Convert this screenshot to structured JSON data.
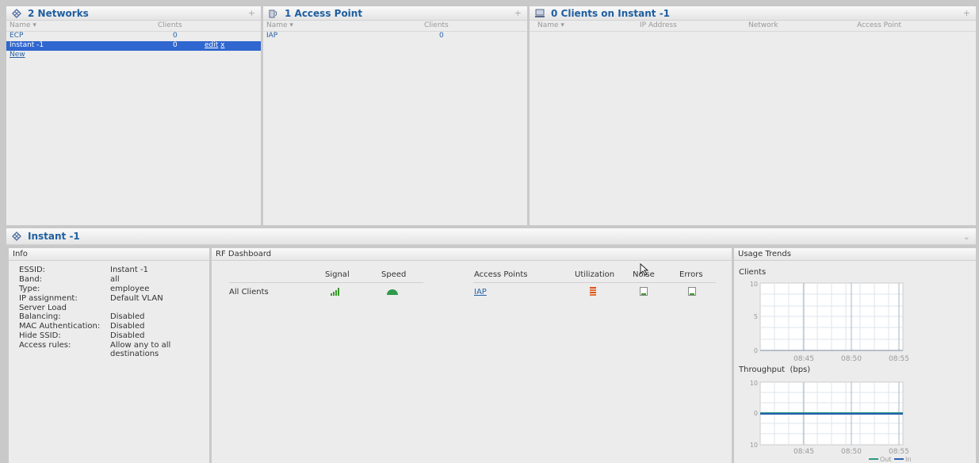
{
  "networks": {
    "title": "2 Networks",
    "columns": [
      "Name",
      "Clients"
    ],
    "rows": [
      {
        "name": "ECP",
        "clients": "0"
      },
      {
        "name": "Instant -1",
        "clients": "0",
        "edit": "edit",
        "remove": "x"
      }
    ],
    "new_link": "New"
  },
  "access_points": {
    "title": "1 Access Point",
    "columns": [
      "Name",
      "Clients"
    ],
    "rows": [
      {
        "name": "IAP",
        "clients": "0"
      }
    ]
  },
  "clients_panel": {
    "title": "0 Clients on Instant -1",
    "columns": [
      "Name",
      "IP Address",
      "Network",
      "Access Point"
    ]
  },
  "detail": {
    "title": "Instant -1",
    "info": {
      "header": "Info",
      "fields": [
        {
          "label": "ESSID:",
          "value": "Instant -1"
        },
        {
          "label": "Band:",
          "value": "all"
        },
        {
          "label": "Type:",
          "value": "employee"
        },
        {
          "label": "IP assignment:",
          "value": "Default VLAN"
        },
        {
          "label": "Server Load Balancing:",
          "value": "Disabled"
        },
        {
          "label": "MAC Authentication:",
          "value": "Disabled"
        },
        {
          "label": "Hide SSID:",
          "value": "Disabled"
        },
        {
          "label": "Access rules:",
          "value": "Allow any to all destinations"
        }
      ]
    },
    "rf": {
      "header": "RF Dashboard",
      "columns_left": [
        "Signal",
        "Speed"
      ],
      "columns_right": [
        "Access Points",
        "Utilization",
        "Noise",
        "Errors"
      ],
      "row_label": "All Clients",
      "ap_link": "IAP"
    },
    "trends": {
      "header": "Usage Trends",
      "clients_chart": {
        "title": "Clients",
        "yticks": [
          "10",
          "5",
          "0"
        ],
        "xticks": [
          "08:45",
          "08:50",
          "08:55"
        ]
      },
      "throughput_chart": {
        "title": "Throughput  (bps)",
        "yticks": [
          "10",
          "0",
          "10"
        ],
        "xticks": [
          "08:45",
          "08:50",
          "08:55"
        ],
        "legend": [
          "Out",
          "In"
        ]
      }
    }
  },
  "colors": {
    "accent": "#2f66cf",
    "title": "#1f5fa0",
    "link": "#2864a8",
    "signal": "#3a9a2a",
    "utilization": "#e05020",
    "throughput_out": "#2a9a80",
    "throughput_in": "#2a5fb0"
  }
}
